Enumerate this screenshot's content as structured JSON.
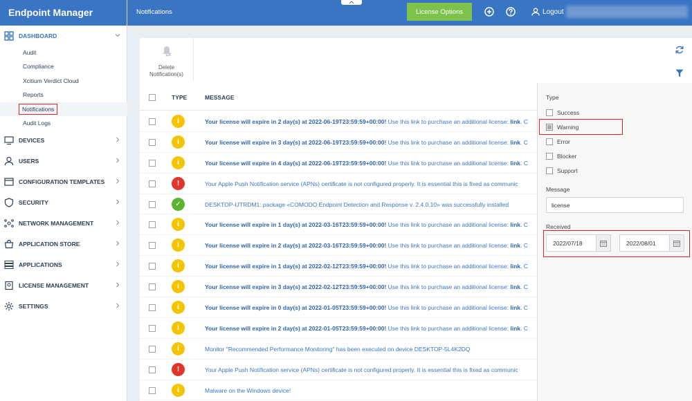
{
  "app": {
    "brand": "Endpoint Manager",
    "page_title": "Notifications"
  },
  "topbar": {
    "license_button": "License Options",
    "logout_label": "Logout"
  },
  "sidebar": {
    "dashboard": {
      "label": "DASHBOARD",
      "items": [
        "Audit",
        "Compliance",
        "Xcitium Verdict Cloud",
        "Reports",
        "Notifications",
        "Audit Logs"
      ]
    },
    "sections": [
      {
        "label": "DEVICES",
        "icon": "devices-icon"
      },
      {
        "label": "USERS",
        "icon": "users-icon"
      },
      {
        "label": "CONFIGURATION TEMPLATES",
        "icon": "configuration-templates-icon"
      },
      {
        "label": "SECURITY",
        "icon": "shield-icon"
      },
      {
        "label": "NETWORK MANAGEMENT",
        "icon": "network-icon"
      },
      {
        "label": "APPLICATION STORE",
        "icon": "store-icon"
      },
      {
        "label": "APPLICATIONS",
        "icon": "applications-icon"
      },
      {
        "label": "LICENSE MANAGEMENT",
        "icon": "license-icon"
      },
      {
        "label": "SETTINGS",
        "icon": "gear-icon"
      }
    ]
  },
  "toolbar": {
    "delete_label_line1": "Delete",
    "delete_label_line2": "Notification(s)"
  },
  "table": {
    "columns": {
      "type": "TYPE",
      "message": "MESSAGE"
    },
    "rows": [
      {
        "type": "warning",
        "bold": "Your license will expire in 2 day(s) at 2022-06-19T23:59:59+00:00!",
        "text": " Use this link to purchase an additional license: ",
        "link": "link",
        "tail": ". C"
      },
      {
        "type": "warning",
        "bold": "Your license will expire in 3 day(s) at 2022-06-19T23:59:59+00:00!",
        "text": " Use this link to purchase an additional license: ",
        "link": "link",
        "tail": ". C"
      },
      {
        "type": "warning",
        "bold": "Your license will expire in 4 day(s) at 2022-06-19T23:59:59+00:00!",
        "text": " Use this link to purchase an additional license: ",
        "link": "link",
        "tail": ". C"
      },
      {
        "type": "error",
        "bold": "",
        "text": "Your Apple Push Notification service (APNs) certificate is not configured properly. It is essential this is fixed as communic",
        "link": "",
        "tail": ""
      },
      {
        "type": "success",
        "bold": "",
        "text": "DESKTOP-IJTRDM1: package «COMODO Endpoint Detection and Response v. 2.4.0.10» was successfully installed",
        "link": "",
        "tail": ""
      },
      {
        "type": "warning",
        "bold": "Your license will expire in 1 day(s) at 2022-03-16T23:59:59+00:00!",
        "text": " Use this link to purchase an additional license: ",
        "link": "link",
        "tail": ". C"
      },
      {
        "type": "warning",
        "bold": "Your license will expire in 2 day(s) at 2022-03-16T23:59:59+00:00!",
        "text": " Use this link to purchase an additional license: ",
        "link": "link",
        "tail": ". C"
      },
      {
        "type": "warning",
        "bold": "Your license will expire in 1 day(s) at 2022-02-12T23:59:59+00:00!",
        "text": " Use this link to purchase an additional license: ",
        "link": "link",
        "tail": ". C"
      },
      {
        "type": "warning",
        "bold": "Your license will expire in 3 day(s) at 2022-02-12T23:59:59+00:00!",
        "text": " Use this link to purchase an additional license: ",
        "link": "link",
        "tail": ". C"
      },
      {
        "type": "warning",
        "bold": "Your license will expire in 0 day(s) at 2022-01-05T23:59:59+00:00!",
        "text": " Use this link to purchase an additional license: ",
        "link": "link",
        "tail": ". C"
      },
      {
        "type": "warning",
        "bold": "Your license will expire in 2 day(s) at 2022-01-05T23:59:59+00:00!",
        "text": " Use this link to purchase an additional license: ",
        "link": "link",
        "tail": ". C"
      },
      {
        "type": "warning",
        "bold": "",
        "text": "Monitor \"Recommended Performance Monitoring\" has been executed on device DESKTOP-5L4K2DQ",
        "link": "",
        "tail": ""
      },
      {
        "type": "error",
        "bold": "",
        "text": "Your Apple Push Notification service (APNs) certificate is not configured properly. It is essential this is fixed as communic",
        "link": "",
        "tail": ""
      },
      {
        "type": "warning",
        "bold": "",
        "text": "Malware on the Windows device!",
        "link": "",
        "tail": ""
      }
    ]
  },
  "filter": {
    "type_label": "Type",
    "types": [
      {
        "label": "Success",
        "checked": false
      },
      {
        "label": "Warning",
        "checked": true
      },
      {
        "label": "Error",
        "checked": false
      },
      {
        "label": "Blocker",
        "checked": false
      },
      {
        "label": "Support",
        "checked": false
      }
    ],
    "message_label": "Message",
    "message_value": "license",
    "received_label": "Received",
    "date_from": "2022/07/18",
    "date_to": "2022/08/01"
  },
  "colors": {
    "primary": "#3a75c4",
    "license_button": "#7dc24b",
    "warning": "#f5c400",
    "error": "#e0352b",
    "success": "#5cb531",
    "highlight": "#e02424"
  }
}
